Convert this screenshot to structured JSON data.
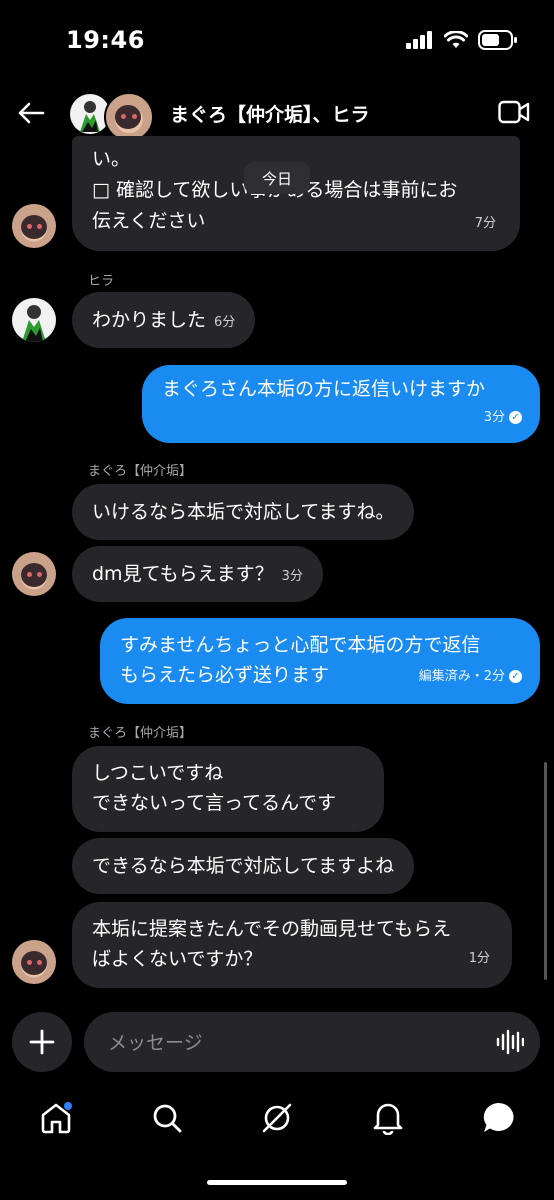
{
  "status_bar": {
    "time": "19:46"
  },
  "header": {
    "title": "まぐろ【仲介垢】、ヒラ"
  },
  "date_pill": "今日",
  "messages": {
    "m1": {
      "line1": "い。",
      "line2": "□ 確認して欲しい事がある場合は事前にお",
      "line3": "伝えください",
      "time": "7分"
    },
    "m2": {
      "sender": "ヒラ",
      "text": "わかりました",
      "time": "6分"
    },
    "m3": {
      "text": "まぐろさん本垢の方に返信いけますか",
      "time": "3分"
    },
    "m4": {
      "sender": "まぐろ【仲介垢】",
      "text": "いけるなら本垢で対応してますね。"
    },
    "m5": {
      "text": "dm見てもらえます？",
      "time": "3分"
    },
    "m6": {
      "line1": "すみませんちょっと心配で本垢の方で返信",
      "line2": "もらえたら必ず送ります",
      "time": "編集済み・2分"
    },
    "m7": {
      "sender": "まぐろ【仲介垢】",
      "line1": "しつこいですね",
      "line2": "できないって言ってるんです"
    },
    "m8": {
      "text": "できるなら本垢で対応してますよね"
    },
    "m9": {
      "line1": "本垢に提案きたんでその動画見せてもらえ",
      "line2": "ばよくないですか？",
      "time": "1分"
    }
  },
  "composer": {
    "placeholder": "メッセージ"
  },
  "colors": {
    "sent_bubble": "#1a8bf0",
    "received_bubble": "#26262a",
    "background": "#000000"
  },
  "icons": {
    "nav": [
      "home-icon",
      "search-icon",
      "explore-icon",
      "notifications-icon",
      "messages-icon"
    ]
  }
}
